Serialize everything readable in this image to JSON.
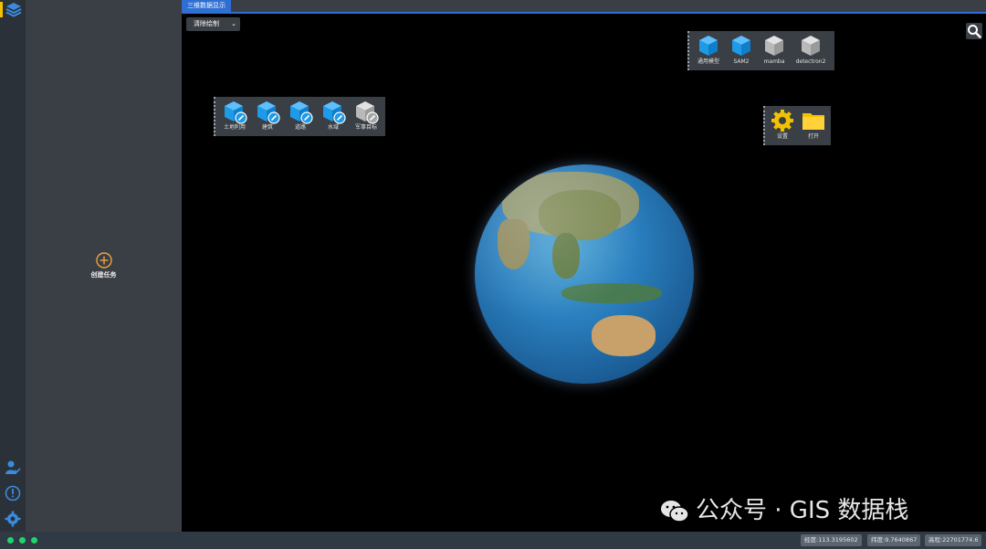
{
  "tab": {
    "label": "三维数据显示"
  },
  "draw_select": {
    "value": "清除绘制"
  },
  "panel": {
    "create_label": "创建任务"
  },
  "toolbar_models": {
    "items": [
      {
        "label": "通用模型",
        "icon": "cube-blue-icon"
      },
      {
        "label": "SAM2",
        "icon": "cube-blue-icon"
      },
      {
        "label": "mamba",
        "icon": "cube-gray-icon"
      },
      {
        "label": "detectron2",
        "icon": "cube-gray-icon"
      }
    ]
  },
  "toolbar_classes": {
    "items": [
      {
        "label": "土地利用",
        "icon": "cube-edit-blue-icon"
      },
      {
        "label": "建筑",
        "icon": "cube-edit-blue-icon"
      },
      {
        "label": "道路",
        "icon": "cube-edit-blue-icon"
      },
      {
        "label": "水域",
        "icon": "cube-edit-blue-icon"
      },
      {
        "label": "军事目标",
        "icon": "cube-edit-gray-icon"
      }
    ]
  },
  "toolbar_settings": {
    "items": [
      {
        "label": "设置",
        "icon": "gear-icon"
      },
      {
        "label": "打开",
        "icon": "folder-icon"
      }
    ]
  },
  "watermark": {
    "text": "公众号 · GIS 数据栈"
  },
  "status": {
    "longitude": "经度:113.3195602",
    "latitude": "纬度:9.7640867",
    "altitude": "高程:22701774.6"
  },
  "colors": {
    "accent": "#2f6fd3",
    "cube_blue": "#1e9be8",
    "gold": "#f2c200",
    "status_green": "#22d36b"
  }
}
